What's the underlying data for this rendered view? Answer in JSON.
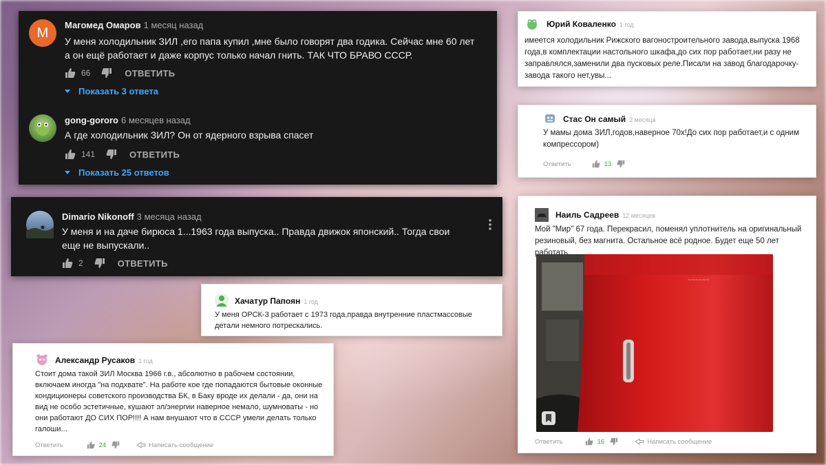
{
  "comments_dark": [
    {
      "author": "Магомед Омаров",
      "time": "1 месяц назад",
      "avatar_letter": "M",
      "avatar_color": "#e9692b",
      "text": "У меня холодильник ЗИЛ ,его папа купил ,мне было говорят два годика. Сейчас мне 60 лет а он ещё работает и даже корпус только начал гнить. ТАК ЧТО БРАВО СССР.",
      "likes": "66",
      "reply_label": "ОТВЕТИТЬ",
      "show_replies": "Показать 3 ответа"
    },
    {
      "author": "gong-gororo",
      "time": "6 месяцев назад",
      "text": "А где холодильник ЗИЛ? Он от ядерного взрыва спасет",
      "likes": "141",
      "reply_label": "ОТВЕТИТЬ",
      "show_replies": "Показать 25 ответов"
    },
    {
      "author": "Dimario Nikonoff",
      "time": "3 месяца назад",
      "text": "У меня и на даче бирюса 1...1963 года выпуска.. Правда движок японский.. Тогда свои еще не выпускали..",
      "likes": "2",
      "reply_label": "ОТВЕТИТЬ"
    }
  ],
  "comments_light": [
    {
      "author": "Юрий Коваленко",
      "time": "1 год",
      "text": "имеется холодильник Рижского вагоностроительного завода,выпуска 1968 года,в комплектации настольного шкафа,до сих пор работает,ни разу не заправлялся,заменили два пусковых реле.Писали на завод благодарочку-завода такого нет,увы..."
    },
    {
      "author": "Стас Он самый",
      "time": "2 месяца",
      "text": "У мамы дома ЗИЛ,годов,наверное 70х!До сих пор работает,и с одним компрессором)",
      "reply_label": "Ответить",
      "likes": "13"
    },
    {
      "author": "Наиль Садреев",
      "time": "12 месяцев",
      "text": "Мой \"Мир\" 67 года. Перекрасил, поменял уплотнитель на оригинальный резиновый, без магнита. Остальное всё родное. Будет еще 50 лет работать.",
      "reply_label": "Ответить",
      "likes": "16",
      "message_label": "Написать сообщение"
    },
    {
      "author": "Хачатур Папоян",
      "time": "1 год",
      "text": "У меня ОРСК-3 работает с 1973 года,правда внутренние пластмассовые детали немного потрескались."
    },
    {
      "author": "Александр Русаков",
      "time": "1 год",
      "text": "Стоит дома такой ЗИЛ Москва 1966 г.в., абсолютно в рабочем состоянии, включаем иногда \"на подхвате\". На работе кое где попадаются бытовые оконные кондиционеры советского производства БК, в Баку вроде их делали - да, они на вид не особо эстетичные, кушают эл/энергии наверное немало, шумноваты - но они работают ДО СИХ ПОР!!!! А нам внушают что в СССР умели делать только галоши...",
      "reply_label": "Ответить",
      "likes": "24",
      "message_label": "Написать сообщение"
    }
  ],
  "colors": {
    "youtube_bg": "#181818",
    "youtube_link": "#3ea6ff",
    "zen_like_green": "#2db22d",
    "fridge_red": "#d41a1a"
  }
}
